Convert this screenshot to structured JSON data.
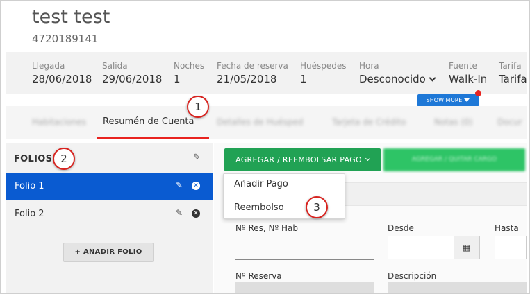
{
  "header": {
    "guest_name": "test test",
    "phone": "4720189141"
  },
  "reservation_info": [
    {
      "label": "Llegada",
      "value": "28/06/2018"
    },
    {
      "label": "Salida",
      "value": "29/06/2018"
    },
    {
      "label": "Noches",
      "value": "1"
    },
    {
      "label": "Fecha de reserva",
      "value": "21/05/2018"
    },
    {
      "label": "Huéspedes",
      "value": "1"
    },
    {
      "label": "Hora",
      "value": "Desconocido"
    },
    {
      "label": "Fuente",
      "value": "Walk-In"
    },
    {
      "label": "Tarifa",
      "value": "Tarifa"
    }
  ],
  "show_more_label": "SHOW MORE",
  "tabs": [
    {
      "label": "Habitaciones"
    },
    {
      "label": "Resumén de Cuenta"
    },
    {
      "label": "Detalles de Huésped"
    },
    {
      "label": "Tarjeta de Crédito"
    },
    {
      "label": "Notas (0)"
    },
    {
      "label": "Docur"
    }
  ],
  "folios": {
    "title": "FOLIOS",
    "items": [
      {
        "label": "Folio 1"
      },
      {
        "label": "Folio 2"
      }
    ],
    "add_button": "AÑADIR FOLIO"
  },
  "actions": {
    "payment_button": "AGREGAR / REEMBOLSAR PAGO",
    "secondary_button": "AGREGAR / QUITAR CARGO",
    "dropdown": [
      "Añadir Pago",
      "Reembolso"
    ]
  },
  "form": {
    "res_label": "Nº Res, Nº Hab",
    "desde_label": "Desde",
    "hasta_label": "Hasta",
    "reserva_label": "Nº Reserva",
    "descripcion_label": "Descripción"
  },
  "callouts": [
    "1",
    "2",
    "3"
  ],
  "colors": {
    "accent_red": "#e8231f",
    "active_blue": "#0a5bd1",
    "button_green": "#21a254",
    "show_more_blue": "#1e78d7"
  }
}
